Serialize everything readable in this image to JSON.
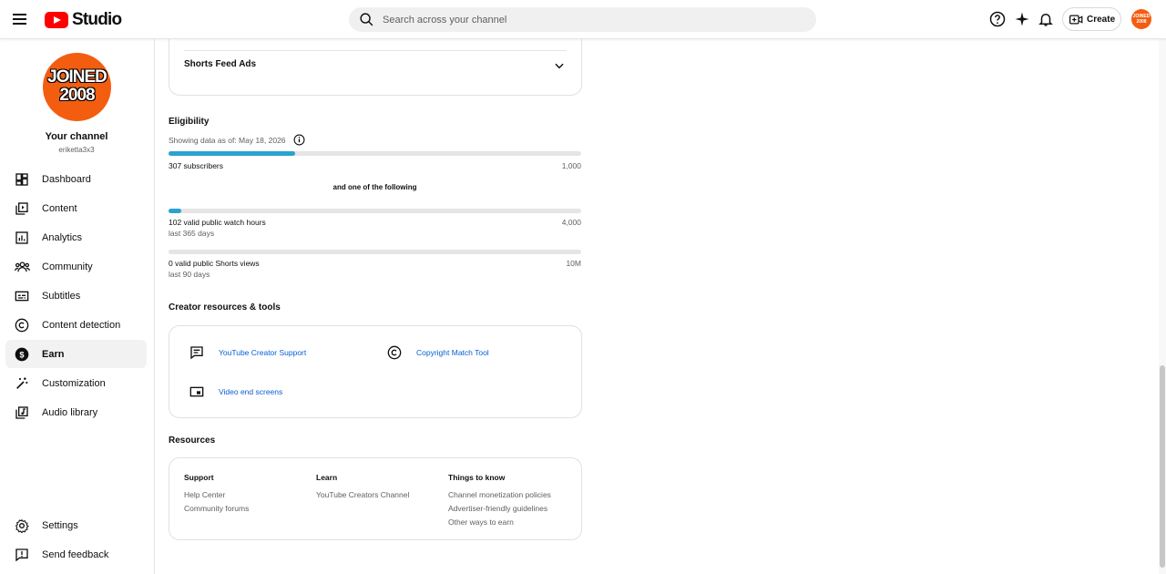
{
  "header": {
    "logo_text": "Studio",
    "search_placeholder": "Search across your channel",
    "create_label": "Create",
    "avatar_text": "JOINED 2008"
  },
  "sidebar": {
    "avatar_line1": "JOINED",
    "avatar_line2": "2008",
    "channel_title": "Your channel",
    "channel_handle": "eriketta3x3",
    "items": [
      {
        "label": "Dashboard",
        "icon": "dashboard-icon"
      },
      {
        "label": "Content",
        "icon": "content-icon"
      },
      {
        "label": "Analytics",
        "icon": "analytics-icon"
      },
      {
        "label": "Community",
        "icon": "community-icon"
      },
      {
        "label": "Subtitles",
        "icon": "subtitles-icon"
      },
      {
        "label": "Content detection",
        "icon": "copyright-icon"
      },
      {
        "label": "Earn",
        "icon": "dollar-icon",
        "active": true
      },
      {
        "label": "Customization",
        "icon": "magic-wand-icon"
      },
      {
        "label": "Audio library",
        "icon": "audio-library-icon"
      }
    ],
    "bottom": [
      {
        "label": "Settings",
        "icon": "gear-icon"
      },
      {
        "label": "Send feedback",
        "icon": "feedback-icon"
      }
    ]
  },
  "main": {
    "shorts_feed_ads": "Shorts Feed Ads",
    "eligibility": {
      "title": "Eligibility",
      "showing_data": "Showing data as of: May 18, 2026",
      "subscribers": {
        "label": "307 subscribers",
        "target": "1,000",
        "progress": 0.307
      },
      "and_one_of": "and one of the following",
      "watch_hours": {
        "label": "102 valid public watch hours",
        "sub": "last 365 days",
        "target": "4,000",
        "progress": 0.03
      },
      "shorts_views": {
        "label": "0 valid public Shorts views",
        "sub": "last 90 days",
        "target": "10M",
        "progress": 0
      }
    },
    "creator_resources": {
      "title": "Creator resources & tools",
      "tools": [
        {
          "label": "YouTube Creator Support",
          "icon": "chat-icon"
        },
        {
          "label": "Copyright Match Tool",
          "icon": "copyright-icon"
        },
        {
          "label": "Video end screens",
          "icon": "end-screen-icon"
        }
      ]
    },
    "resources": {
      "title": "Resources",
      "columns": [
        {
          "heading": "Support",
          "links": [
            "Help Center",
            "Community forums"
          ]
        },
        {
          "heading": "Learn",
          "links": [
            "YouTube Creators Channel"
          ]
        },
        {
          "heading": "Things to know",
          "links": [
            "Channel monetization policies",
            "Advertiser-friendly guidelines",
            "Other ways to earn"
          ]
        }
      ]
    }
  },
  "colors": {
    "accent": "#2ba2d1",
    "link": "#065fd4",
    "brand": "#ff0000",
    "avatar": "#f35d10"
  }
}
